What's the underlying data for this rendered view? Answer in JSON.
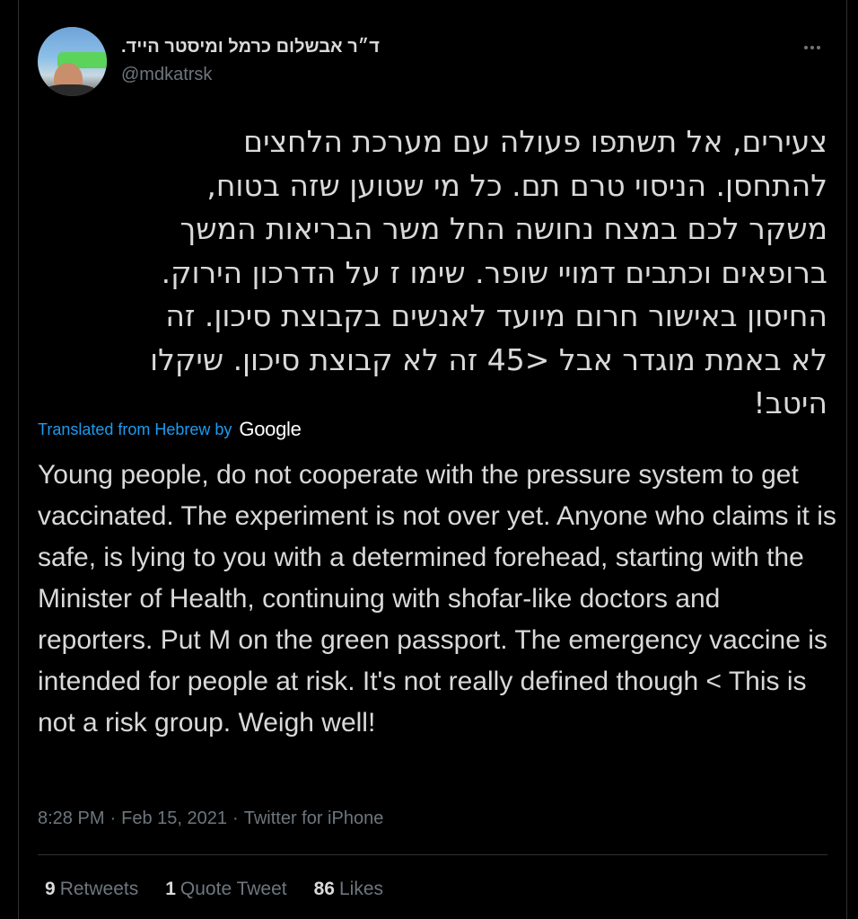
{
  "tweet": {
    "display_name": "ד״ר אבשלום כרמל ומיסטר הייד.",
    "handle": "@mdkatrsk",
    "original_text": "צעירים, אל תשתפו פעולה עם מערכת הלחצים\nלהתחסן. הניסוי טרם תם. כל מי שטוען שזה בטוח,\nמשקר לכם במצח נחושה החל משר הבריאות המשך\nברופאים וכתבים דמויי שופר. שימו ז על הדרכון הירוק.\nהחיסון באישור חרום מיועד לאנשים בקבוצת סיכון. זה\nלא באמת מוגדר אבל <45 זה לא קבוצת סיכון. שיקלו\nהיטב!",
    "translated_label": "Translated from Hebrew by",
    "translator": "Google",
    "translation": "Young people, do not cooperate with the pressure system to get vaccinated. The experiment is not over yet. Anyone who claims it is safe, is lying to you with a determined forehead, starting with the Minister of Health, continuing with shofar-like doctors and reporters. Put M on the green passport. The emergency vaccine is intended for people at risk. It's not really defined though < This is not a risk group. Weigh well!",
    "time": "8:28 PM",
    "date": "Feb 15, 2021",
    "source": "Twitter for iPhone",
    "separator": "·"
  },
  "stats": {
    "retweets_count": "9",
    "retweets_label": "Retweets",
    "quote_count": "1",
    "quote_label": "Quote Tweet",
    "likes_count": "86",
    "likes_label": "Likes"
  },
  "icons": {
    "more": "more-horizontal-icon",
    "avatar": "avatar"
  },
  "colors": {
    "background": "#000000",
    "text": "#d9d9d9",
    "muted": "#6e767d",
    "link": "#1d9bf0",
    "divider": "#2f3336"
  }
}
